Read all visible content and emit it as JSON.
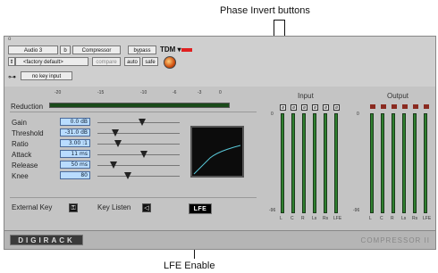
{
  "callouts": {
    "phase": "Phase Invert buttons",
    "lfe": "LFE Enable"
  },
  "header": {
    "track": "Audio 3",
    "slot": "b",
    "plugin": "Compressor",
    "bypass": "bypass",
    "tdm": "TDM",
    "preset": "<factory default>",
    "compare": "compare",
    "auto": "auto",
    "safe": "safe",
    "key_input": "no key input"
  },
  "reduction": {
    "label": "Reduction",
    "scale": [
      "-20",
      "-15",
      "-10",
      "-6",
      "-3",
      "0"
    ]
  },
  "params": [
    {
      "label": "Gain",
      "value": "0.0 dB",
      "level": 0.52
    },
    {
      "label": "Threshold",
      "value": "-31.0 dB",
      "level": 0.18
    },
    {
      "label": "Ratio",
      "value": "3.00 :1",
      "level": 0.22
    },
    {
      "label": "Attack",
      "value": "11 ms",
      "level": 0.55
    },
    {
      "label": "Release",
      "value": "50 ms",
      "level": 0.16
    },
    {
      "label": "Knee",
      "value": "80",
      "level": 0.34
    }
  ],
  "footer_controls": {
    "external_key": "External Key",
    "key_listen": "Key Listen",
    "lfe": "LFE"
  },
  "input": {
    "title": "Input",
    "phase_symbol": "ø",
    "channels": [
      "L",
      "C",
      "R",
      "Ls",
      "Rs",
      "LFE"
    ],
    "top_tick": "0",
    "bottom_tick": "-96"
  },
  "output": {
    "title": "Output",
    "channels": [
      "L",
      "C",
      "R",
      "Ls",
      "Rs",
      "LFE"
    ],
    "top_tick": "0",
    "bottom_tick": "-96"
  },
  "branding": {
    "logo": "DIGIRACK",
    "plugin_name": "COMPRESSOR II"
  },
  "colors": {
    "value_box": "#b9dcff",
    "meter": "#2f7f2f",
    "bypass_led": "#e02020"
  }
}
